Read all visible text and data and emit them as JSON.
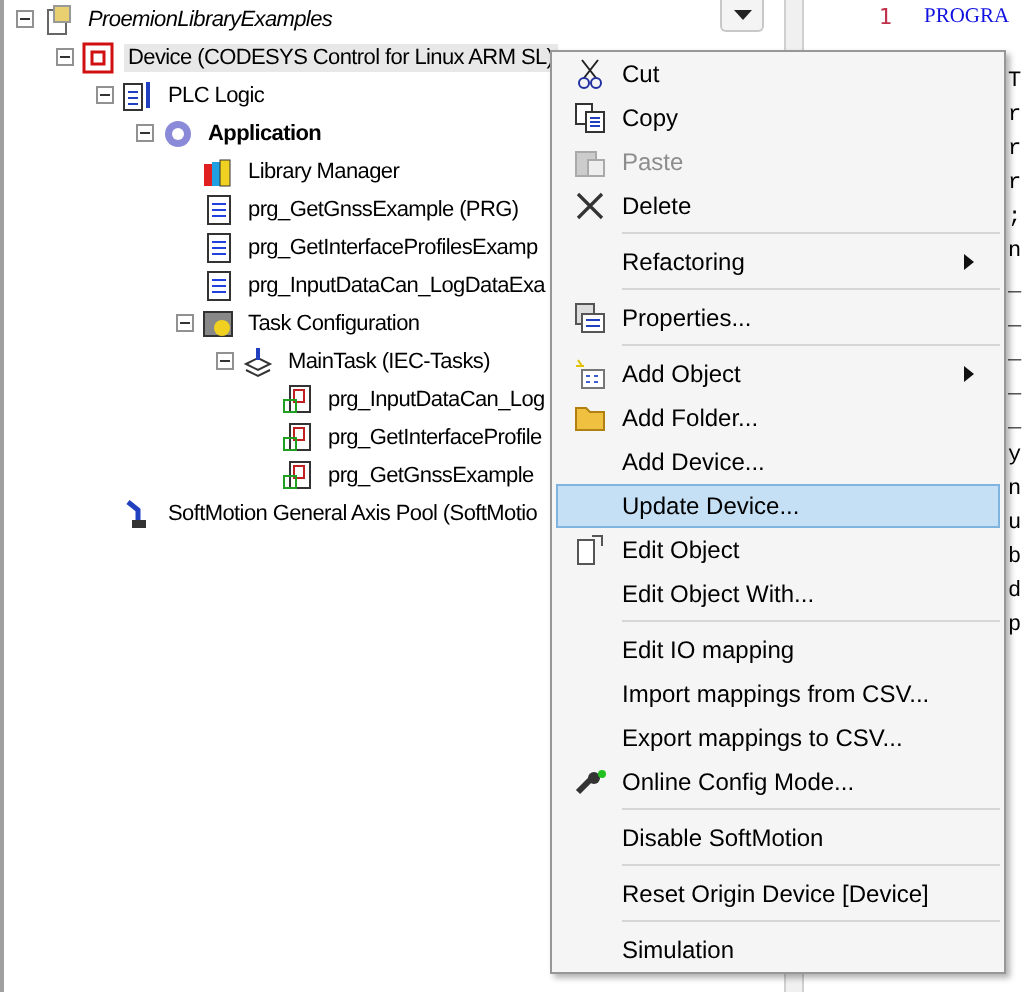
{
  "tree": [
    {
      "label": "ProemionLibraryExamples",
      "kind": "project",
      "italic": true,
      "selected": false,
      "expanded": true,
      "children": [
        {
          "label": "Device (CODESYS Control for Linux ARM SL)",
          "kind": "device",
          "selected": true,
          "expanded": true,
          "children": [
            {
              "label": "PLC Logic",
              "kind": "plc",
              "selected": false,
              "expanded": true,
              "children": [
                {
                  "label": "Application",
                  "kind": "application",
                  "bold": true,
                  "selected": false,
                  "expanded": true,
                  "children": [
                    {
                      "label": "Library Manager",
                      "kind": "library",
                      "selected": false
                    },
                    {
                      "label": "prg_GetGnssExample (PRG)",
                      "kind": "pou",
                      "selected": false
                    },
                    {
                      "label": "prg_GetInterfaceProfilesExamp",
                      "kind": "pou",
                      "selected": false
                    },
                    {
                      "label": "prg_InputDataCan_LogDataExa",
                      "kind": "pou",
                      "selected": false
                    },
                    {
                      "label": "Task Configuration",
                      "kind": "tasks",
                      "selected": false,
                      "expanded": true,
                      "children": [
                        {
                          "label": "MainTask (IEC-Tasks)",
                          "kind": "task",
                          "selected": false,
                          "expanded": true,
                          "children": [
                            {
                              "label": "prg_InputDataCan_Log",
                              "kind": "call",
                              "selected": false
                            },
                            {
                              "label": "prg_GetInterfaceProfile",
                              "kind": "call",
                              "selected": false
                            },
                            {
                              "label": "prg_GetGnssExample",
                              "kind": "call",
                              "selected": false
                            }
                          ]
                        }
                      ]
                    }
                  ]
                }
              ]
            },
            {
              "label": "SoftMotion General Axis Pool (SoftMotio",
              "kind": "axis",
              "selected": false
            }
          ]
        }
      ]
    }
  ],
  "editor": {
    "line_numbers": [
      "1"
    ],
    "lines": [
      "PROGRA"
    ],
    "fragments": [
      "T",
      "r",
      "r",
      "r",
      ";",
      "n",
      "_",
      "_",
      "_",
      "_",
      "_",
      "y",
      "n",
      "u",
      "b",
      "d",
      "p"
    ]
  },
  "menu": [
    {
      "kind": "item",
      "label": "Cut",
      "disabled": false,
      "selected": false,
      "submenu": false
    },
    {
      "kind": "item",
      "label": "Copy",
      "disabled": false,
      "selected": false,
      "submenu": false
    },
    {
      "kind": "item",
      "label": "Paste",
      "disabled": true,
      "selected": false,
      "submenu": false
    },
    {
      "kind": "item",
      "label": "Delete",
      "disabled": false,
      "selected": false,
      "submenu": false
    },
    {
      "kind": "separator"
    },
    {
      "kind": "item",
      "label": "Refactoring",
      "disabled": false,
      "selected": false,
      "submenu": true
    },
    {
      "kind": "separator"
    },
    {
      "kind": "item",
      "label": "Properties...",
      "disabled": false,
      "selected": false,
      "submenu": false
    },
    {
      "kind": "separator"
    },
    {
      "kind": "item",
      "label": "Add Object",
      "disabled": false,
      "selected": false,
      "submenu": true
    },
    {
      "kind": "item",
      "label": "Add Folder...",
      "disabled": false,
      "selected": false,
      "submenu": false
    },
    {
      "kind": "item",
      "label": "Add Device...",
      "disabled": false,
      "selected": false,
      "submenu": false
    },
    {
      "kind": "item",
      "label": "Update Device...",
      "disabled": false,
      "selected": true,
      "submenu": false
    },
    {
      "kind": "item",
      "label": "Edit Object",
      "disabled": false,
      "selected": false,
      "submenu": false
    },
    {
      "kind": "item",
      "label": "Edit Object With...",
      "disabled": false,
      "selected": false,
      "submenu": false
    },
    {
      "kind": "separator"
    },
    {
      "kind": "item",
      "label": "Edit IO mapping",
      "disabled": false,
      "selected": false,
      "submenu": false
    },
    {
      "kind": "item",
      "label": "Import mappings from CSV...",
      "disabled": false,
      "selected": false,
      "submenu": false
    },
    {
      "kind": "item",
      "label": "Export mappings to CSV...",
      "disabled": false,
      "selected": false,
      "submenu": false
    },
    {
      "kind": "item",
      "label": "Online Config Mode...",
      "disabled": false,
      "selected": false,
      "submenu": false
    },
    {
      "kind": "separator"
    },
    {
      "kind": "item",
      "label": "Disable SoftMotion",
      "disabled": false,
      "selected": false,
      "submenu": false
    },
    {
      "kind": "separator"
    },
    {
      "kind": "item",
      "label": "Reset Origin Device [Device]",
      "disabled": false,
      "selected": false,
      "submenu": false
    },
    {
      "kind": "separator"
    },
    {
      "kind": "item",
      "label": "Simulation",
      "disabled": false,
      "selected": false,
      "submenu": false
    }
  ]
}
